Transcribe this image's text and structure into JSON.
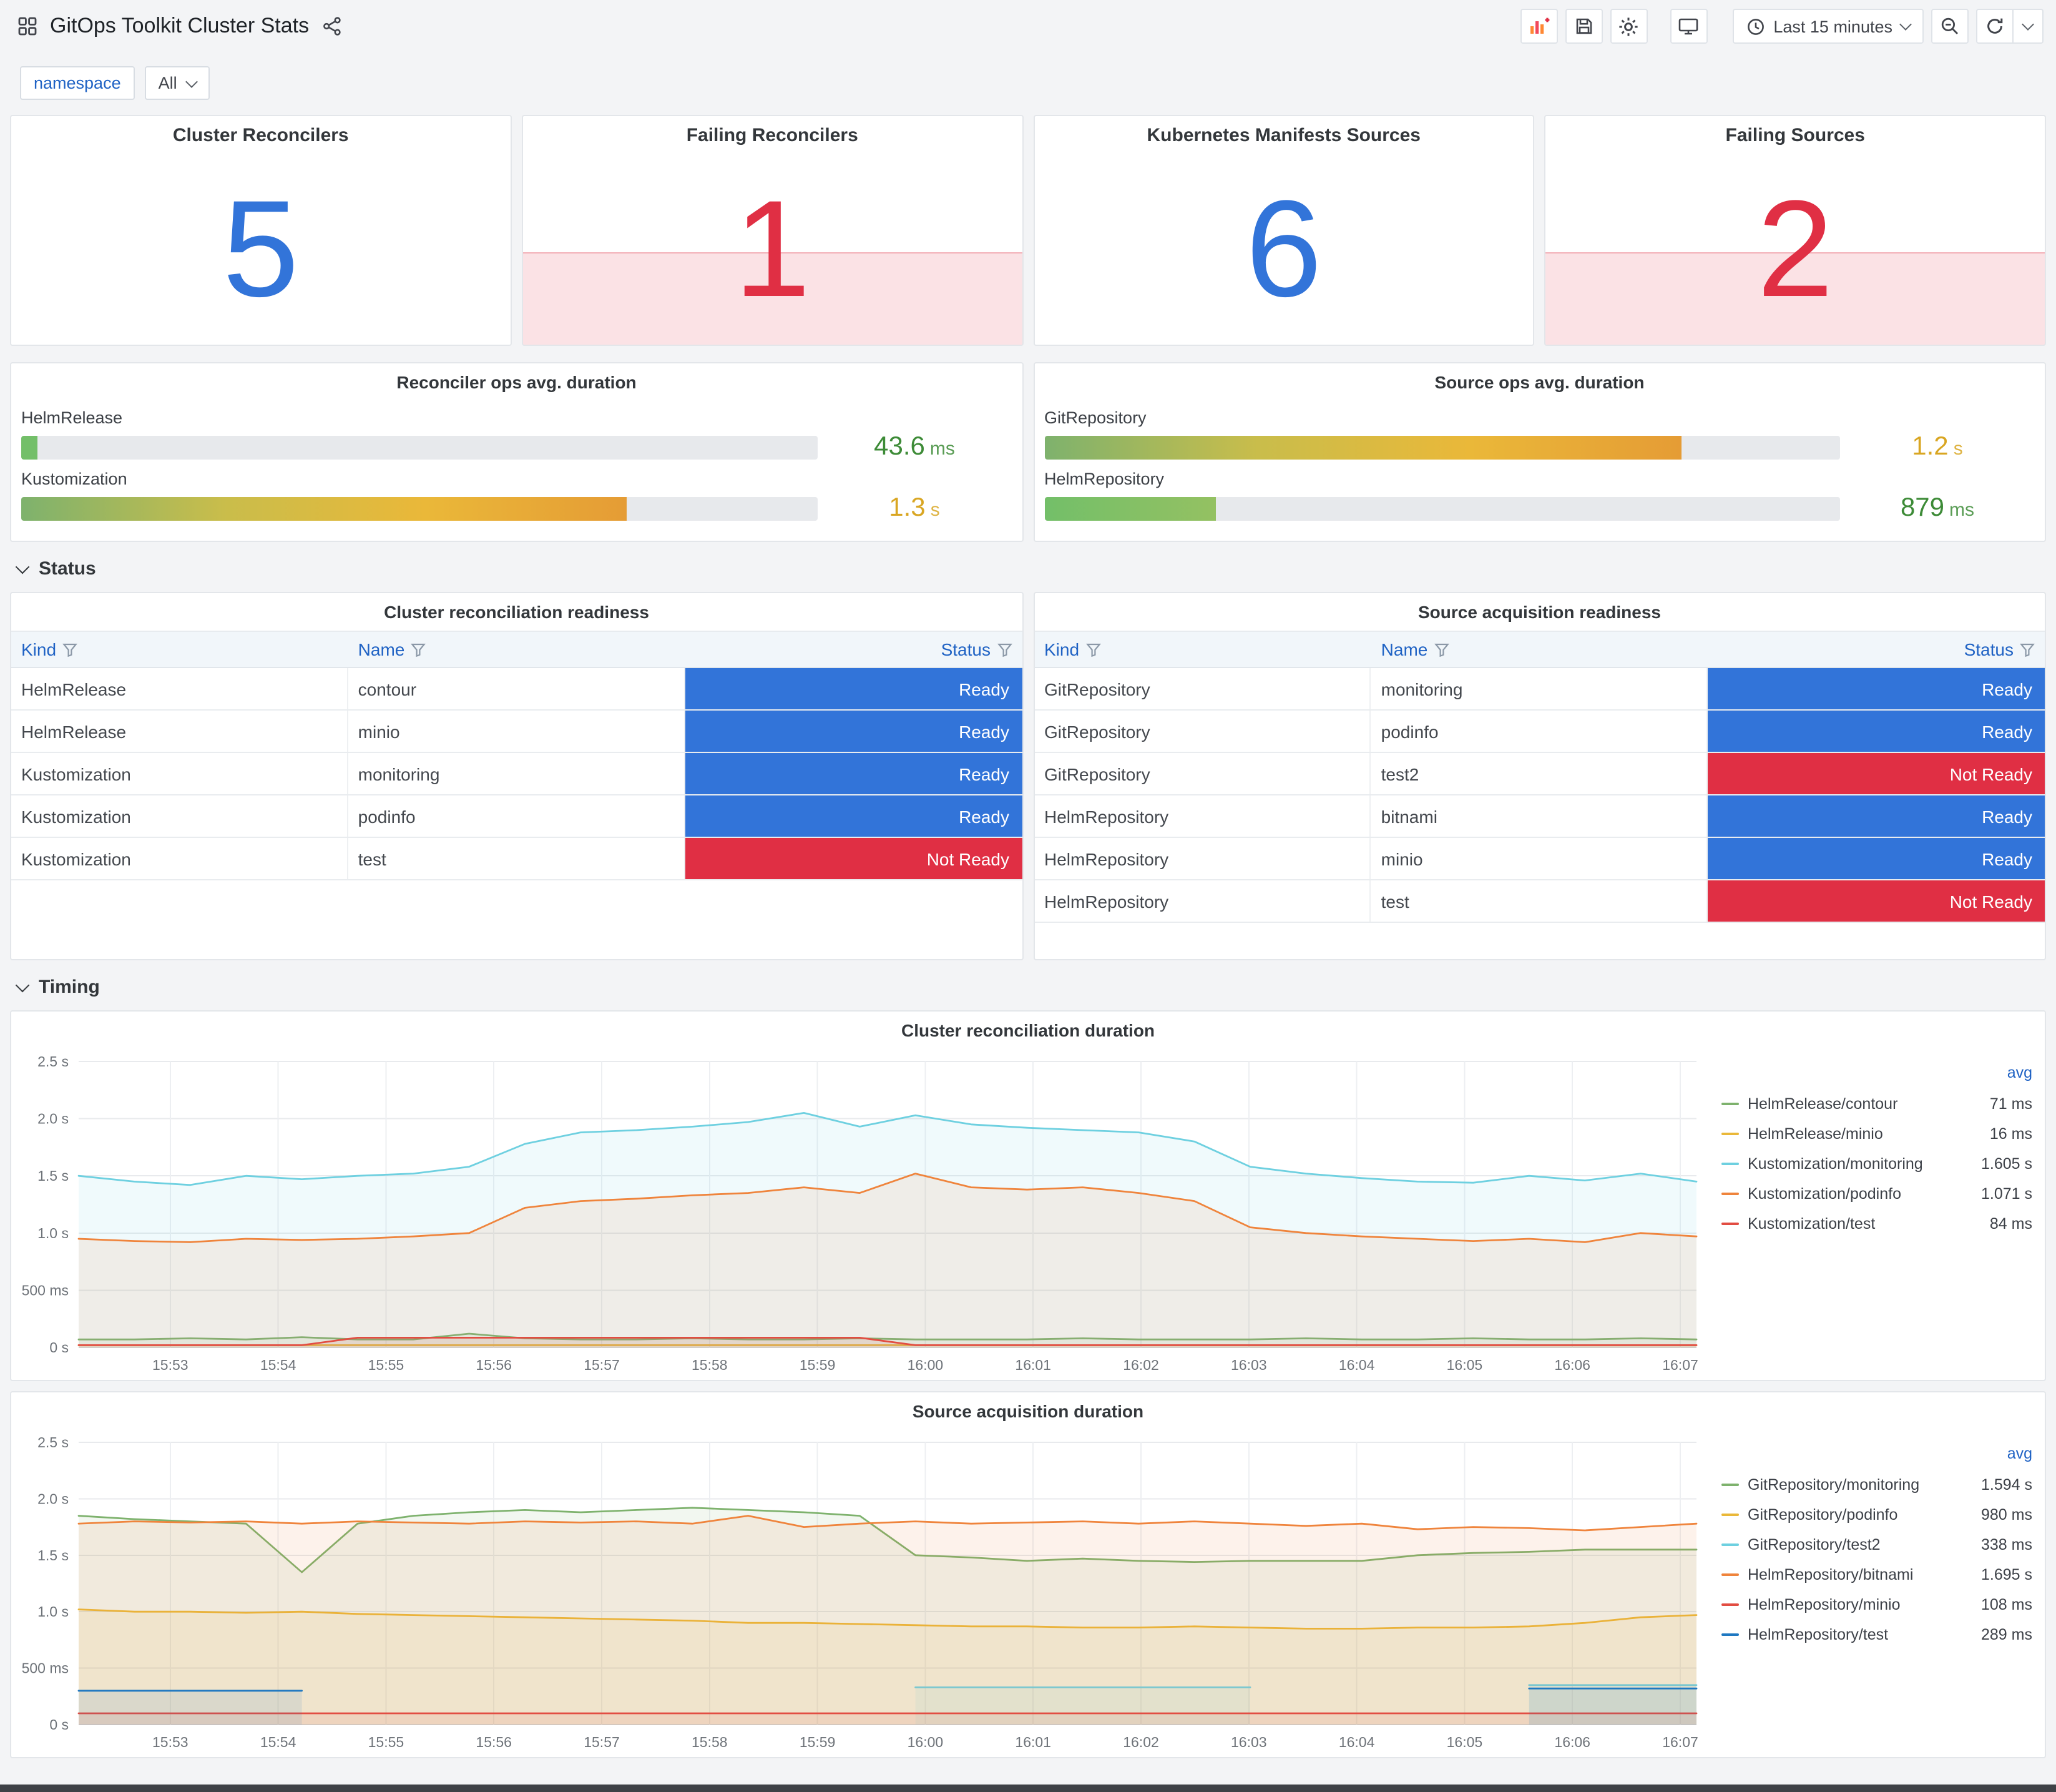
{
  "header": {
    "title": "GitOps Toolkit Cluster Stats"
  },
  "toolbar": {
    "time_range": "Last 15 minutes",
    "buttons": [
      "add-panel",
      "save-dashboard",
      "dashboard-settings",
      "cycle-view-mode",
      "time-picker",
      "zoom-out-time-range",
      "refresh",
      "refresh-picker-caret"
    ],
    "icons": [
      "apps-grid-icon",
      "share-icon",
      "add-panel-icon",
      "save-icon",
      "gear-icon",
      "monitor-icon",
      "clock-icon",
      "chevron-down-icon",
      "zoom-out-icon",
      "refresh-icon",
      "filter-funnel-icon"
    ]
  },
  "variables": {
    "label": "namespace",
    "value": "All"
  },
  "colors": {
    "stat_ok": "#3274d9",
    "stat_alert": "#e02f44",
    "status_bg": {
      "Ready": "#3274d9",
      "Not Ready": "#e02f44"
    },
    "link_blue": "#1f62c4"
  },
  "stats": [
    {
      "title": "Cluster Reconcilers",
      "value": "5",
      "alert": false
    },
    {
      "title": "Failing Reconcilers",
      "value": "1",
      "alert": true
    },
    {
      "title": "Kubernetes Manifests Sources",
      "value": "6",
      "alert": false
    },
    {
      "title": "Failing Sources",
      "value": "2",
      "alert": true
    }
  ],
  "gauges": [
    {
      "title": "Reconciler ops avg. duration",
      "rows": [
        {
          "label": "HelmRelease",
          "value": "43.6",
          "unit": "ms",
          "pct": 2,
          "value_color": "#3d8b37",
          "bar_colors": [
            "#73bf69"
          ]
        },
        {
          "label": "Kustomization",
          "value": "1.3",
          "unit": "s",
          "pct": 76,
          "value_color": "#d9a622",
          "bar_colors": [
            "#7eb26d",
            "#c9bd4b",
            "#eab839",
            "#e59c35"
          ]
        }
      ]
    },
    {
      "title": "Source ops avg. duration",
      "rows": [
        {
          "label": "GitRepository",
          "value": "1.2",
          "unit": "s",
          "pct": 80,
          "value_color": "#d9a622",
          "bar_colors": [
            "#7eb26d",
            "#c9bd4b",
            "#eab839",
            "#e59c35"
          ]
        },
        {
          "label": "HelmRepository",
          "value": "879",
          "unit": "ms",
          "pct": 21.5,
          "value_color": "#3d8b37",
          "bar_colors": [
            "#73bf69",
            "#94c162"
          ]
        }
      ]
    }
  ],
  "sections": {
    "status": "Status",
    "timing": "Timing"
  },
  "tables": [
    {
      "title": "Cluster reconciliation readiness",
      "columns": [
        "Kind",
        "Name",
        "Status"
      ],
      "rows": [
        [
          "HelmRelease",
          "contour",
          "Ready"
        ],
        [
          "HelmRelease",
          "minio",
          "Ready"
        ],
        [
          "Kustomization",
          "monitoring",
          "Ready"
        ],
        [
          "Kustomization",
          "podinfo",
          "Ready"
        ],
        [
          "Kustomization",
          "test",
          "Not Ready"
        ]
      ]
    },
    {
      "title": "Source acquisition readiness",
      "columns": [
        "Kind",
        "Name",
        "Status"
      ],
      "rows": [
        [
          "GitRepository",
          "monitoring",
          "Ready"
        ],
        [
          "GitRepository",
          "podinfo",
          "Ready"
        ],
        [
          "GitRepository",
          "test2",
          "Not Ready"
        ],
        [
          "HelmRepository",
          "bitnami",
          "Ready"
        ],
        [
          "HelmRepository",
          "minio",
          "Ready"
        ],
        [
          "HelmRepository",
          "test",
          "Not Ready"
        ]
      ]
    }
  ],
  "chart_data": [
    {
      "type": "line",
      "title": "Cluster reconciliation duration",
      "x_ticks": [
        "15:53",
        "15:54",
        "15:55",
        "15:56",
        "15:57",
        "15:58",
        "15:59",
        "16:00",
        "16:01",
        "16:02",
        "16:03",
        "16:04",
        "16:05",
        "16:06",
        "16:07"
      ],
      "y_tick_values": [
        0,
        0.5,
        1.0,
        1.5,
        2.0,
        2.5
      ],
      "y_tick_labels": [
        "0 s",
        "500 ms",
        "1.0 s",
        "1.5 s",
        "2.0 s",
        "2.5 s"
      ],
      "ylim": [
        0,
        2.5
      ],
      "legend_header": "avg",
      "legend_position": "right",
      "grid": true,
      "series": [
        {
          "name": "HelmRelease/contour",
          "avg": "71 ms",
          "color": "#7eb26d",
          "values": [
            0.07,
            0.07,
            0.08,
            0.07,
            0.09,
            0.07,
            0.07,
            0.12,
            0.08,
            0.07,
            0.07,
            0.08,
            0.07,
            0.07,
            0.08,
            0.07,
            0.07,
            0.07,
            0.08,
            0.07,
            0.07,
            0.07,
            0.08,
            0.07,
            0.07,
            0.08,
            0.07,
            0.07,
            0.08,
            0.07
          ]
        },
        {
          "name": "HelmRelease/minio",
          "avg": "16 ms",
          "color": "#eab839",
          "values": [
            0.02,
            0.02,
            0.02,
            0.02,
            0.02,
            0.02,
            0.02,
            0.02,
            0.02,
            0.02,
            0.02,
            0.02,
            0.02,
            0.02,
            0.02,
            0.02,
            0.02,
            0.02,
            0.02,
            0.02,
            0.02,
            0.02,
            0.02,
            0.02,
            0.02,
            0.02,
            0.02,
            0.02,
            0.02,
            0.02
          ]
        },
        {
          "name": "Kustomization/monitoring",
          "avg": "1.605 s",
          "color": "#6ed0e0",
          "values": [
            1.5,
            1.45,
            1.42,
            1.5,
            1.47,
            1.5,
            1.52,
            1.58,
            1.78,
            1.88,
            1.9,
            1.93,
            1.97,
            2.05,
            1.93,
            2.03,
            1.95,
            1.92,
            1.9,
            1.88,
            1.8,
            1.58,
            1.52,
            1.48,
            1.45,
            1.44,
            1.5,
            1.46,
            1.52,
            1.45
          ]
        },
        {
          "name": "Kustomization/podinfo",
          "avg": "1.071 s",
          "color": "#ef843c",
          "values": [
            0.95,
            0.93,
            0.92,
            0.95,
            0.94,
            0.95,
            0.97,
            1.0,
            1.22,
            1.28,
            1.3,
            1.33,
            1.35,
            1.4,
            1.35,
            1.52,
            1.4,
            1.38,
            1.4,
            1.35,
            1.28,
            1.05,
            1.0,
            0.97,
            0.95,
            0.93,
            0.95,
            0.92,
            1.0,
            0.97
          ]
        },
        {
          "name": "Kustomization/test",
          "avg": "84 ms",
          "color": "#e24d42",
          "values": [
            0.02,
            0.02,
            0.02,
            0.02,
            0.02,
            0.085,
            0.085,
            0.085,
            0.085,
            0.085,
            0.085,
            0.085,
            0.085,
            0.085,
            0.085,
            0.02,
            0.02,
            0.02,
            0.02,
            0.02,
            0.02,
            0.02,
            0.02,
            0.02,
            0.02,
            0.02,
            0.02,
            0.02,
            0.02,
            0.02
          ]
        }
      ]
    },
    {
      "type": "line",
      "title": "Source acquisition duration",
      "x_ticks": [
        "15:53",
        "15:54",
        "15:55",
        "15:56",
        "15:57",
        "15:58",
        "15:59",
        "16:00",
        "16:01",
        "16:02",
        "16:03",
        "16:04",
        "16:05",
        "16:06",
        "16:07"
      ],
      "y_tick_values": [
        0,
        0.5,
        1.0,
        1.5,
        2.0,
        2.5
      ],
      "y_tick_labels": [
        "0 s",
        "500 ms",
        "1.0 s",
        "1.5 s",
        "2.0 s",
        "2.5 s"
      ],
      "ylim": [
        0,
        2.5
      ],
      "legend_header": "avg",
      "legend_position": "right",
      "grid": true,
      "series": [
        {
          "name": "GitRepository/monitoring",
          "avg": "1.594 s",
          "color": "#7eb26d",
          "values": [
            1.85,
            1.82,
            1.8,
            1.78,
            1.35,
            1.78,
            1.85,
            1.88,
            1.9,
            1.88,
            1.9,
            1.92,
            1.9,
            1.88,
            1.85,
            1.5,
            1.48,
            1.45,
            1.47,
            1.45,
            1.44,
            1.45,
            1.45,
            1.45,
            1.5,
            1.52,
            1.53,
            1.55,
            1.55,
            1.55
          ]
        },
        {
          "name": "GitRepository/podinfo",
          "avg": "980 ms",
          "color": "#eab839",
          "values": [
            1.02,
            1.0,
            1.0,
            0.99,
            1.0,
            0.98,
            0.97,
            0.96,
            0.95,
            0.94,
            0.93,
            0.92,
            0.9,
            0.9,
            0.89,
            0.88,
            0.87,
            0.87,
            0.86,
            0.86,
            0.87,
            0.86,
            0.85,
            0.85,
            0.86,
            0.86,
            0.87,
            0.9,
            0.95,
            0.97
          ]
        },
        {
          "name": "GitRepository/test2",
          "avg": "338 ms",
          "color": "#6ed0e0",
          "values": [
            null,
            null,
            null,
            null,
            null,
            null,
            null,
            null,
            null,
            null,
            null,
            null,
            null,
            null,
            null,
            0.33,
            0.33,
            0.33,
            0.33,
            0.33,
            0.33,
            0.33,
            null,
            null,
            null,
            null,
            0.35,
            0.35,
            0.35,
            0.35
          ]
        },
        {
          "name": "HelmRepository/bitnami",
          "avg": "1.695 s",
          "color": "#ef843c",
          "values": [
            1.78,
            1.8,
            1.79,
            1.8,
            1.78,
            1.8,
            1.79,
            1.78,
            1.8,
            1.79,
            1.8,
            1.78,
            1.85,
            1.75,
            1.78,
            1.8,
            1.78,
            1.79,
            1.8,
            1.78,
            1.8,
            1.78,
            1.76,
            1.78,
            1.73,
            1.75,
            1.74,
            1.72,
            1.75,
            1.78
          ]
        },
        {
          "name": "HelmRepository/minio",
          "avg": "108 ms",
          "color": "#e24d42",
          "values": [
            0.1,
            0.1,
            0.1,
            0.1,
            0.1,
            0.1,
            0.1,
            0.1,
            0.1,
            0.1,
            0.1,
            0.1,
            0.1,
            0.1,
            0.1,
            0.1,
            0.1,
            0.1,
            0.1,
            0.1,
            0.1,
            0.1,
            0.1,
            0.1,
            0.1,
            0.1,
            0.1,
            0.1,
            0.1,
            0.1
          ]
        },
        {
          "name": "HelmRepository/test",
          "avg": "289 ms",
          "color": "#1f78c1",
          "values": [
            0.3,
            0.3,
            0.3,
            0.3,
            0.3,
            null,
            null,
            null,
            null,
            null,
            null,
            null,
            null,
            null,
            null,
            null,
            null,
            null,
            null,
            null,
            null,
            null,
            null,
            null,
            null,
            null,
            0.32,
            0.32,
            0.32,
            0.32
          ]
        }
      ]
    }
  ]
}
